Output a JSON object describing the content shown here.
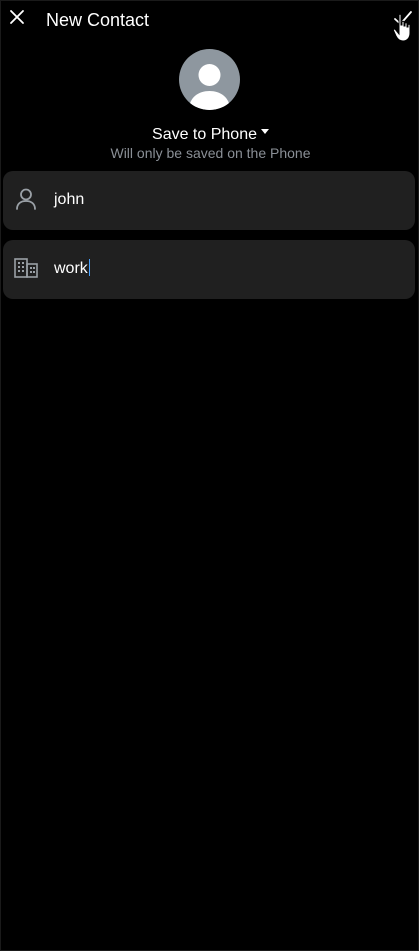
{
  "header": {
    "title": "New Contact",
    "close_icon": "close-icon",
    "confirm_icon": "check-icon"
  },
  "avatar": {
    "icon": "person-avatar-icon",
    "color": "#8e979f"
  },
  "account": {
    "selected": "Save to Phone",
    "note": "Will only be saved on the Phone"
  },
  "fields": {
    "name": {
      "icon": "person-icon",
      "value": "john"
    },
    "company": {
      "icon": "building-icon",
      "value": "work"
    }
  },
  "colors": {
    "background": "#000000",
    "field_background": "#202020",
    "muted_text": "#8a8f96",
    "caret": "#4aa3ff"
  }
}
